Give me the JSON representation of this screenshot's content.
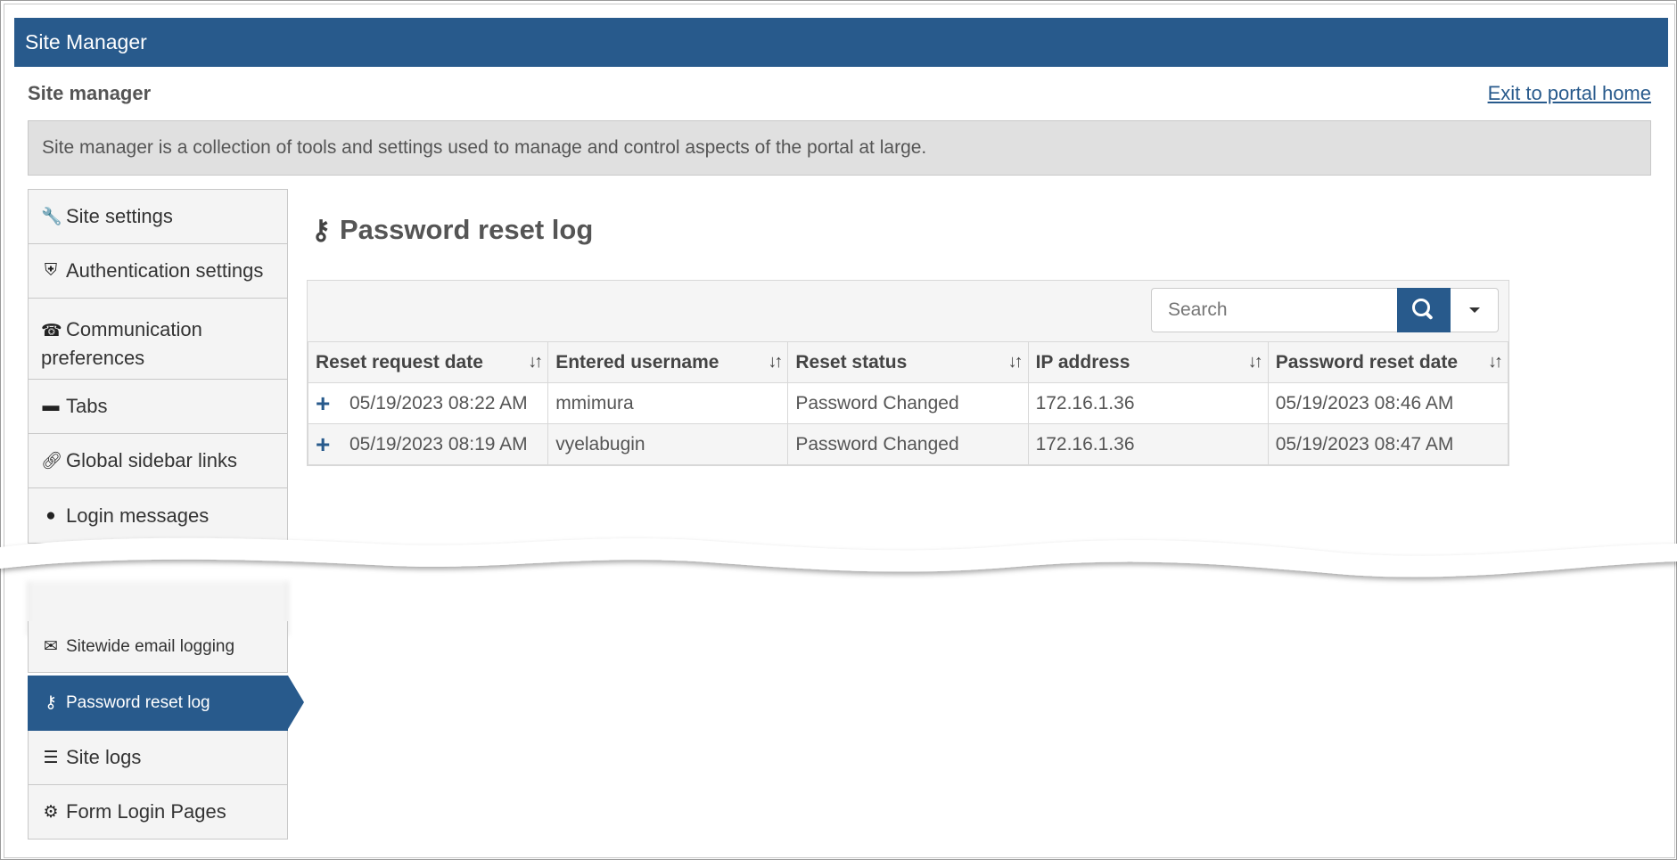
{
  "titlebar": {
    "title": "Site Manager"
  },
  "header": {
    "section_title": "Site manager",
    "exit_link": "Exit to portal home",
    "description": "Site manager is a collection of tools and settings used to manage and control aspects of the portal at large."
  },
  "sidebar": {
    "items": [
      {
        "label": "Site settings",
        "icon": "wrench-icon"
      },
      {
        "label": "Authentication settings",
        "icon": "shield-icon"
      },
      {
        "label_line1": "Communication",
        "label_line2": "preferences",
        "icon": "telephone-icon"
      },
      {
        "label": "Tabs",
        "icon": "folder-icon"
      },
      {
        "label": "Global sidebar links",
        "icon": "link-icon"
      },
      {
        "label": "Login messages",
        "icon": "speech-bubble-icon"
      },
      {
        "label": "Sitewide email logging",
        "icon": "envelope-icon"
      },
      {
        "label": "Password reset log",
        "icon": "keys-icon",
        "active": true
      },
      {
        "label": "Site logs",
        "icon": "list-icon"
      },
      {
        "label": "Form Login Pages",
        "icon": "cogs-icon"
      }
    ]
  },
  "main": {
    "title": "Password reset log",
    "title_icon": "keys-icon",
    "search": {
      "placeholder": "Search"
    },
    "columns": [
      "Reset request date",
      "Entered username",
      "Reset status",
      "IP address",
      "Password reset date"
    ],
    "rows": [
      {
        "request_date": "05/19/2023 08:22 AM",
        "username": "mmimura",
        "status": "Password Changed",
        "ip": "172.16.1.36",
        "reset_date": "05/19/2023 08:46 AM"
      },
      {
        "request_date": "05/19/2023 08:19 AM",
        "username": "vyelabugin",
        "status": "Password Changed",
        "ip": "172.16.1.36",
        "reset_date": "05/19/2023 08:47 AM"
      }
    ]
  },
  "colors": {
    "brand": "#285a8c",
    "panel": "#e0e0e0",
    "sidebar_bg": "#f4f4f4"
  }
}
